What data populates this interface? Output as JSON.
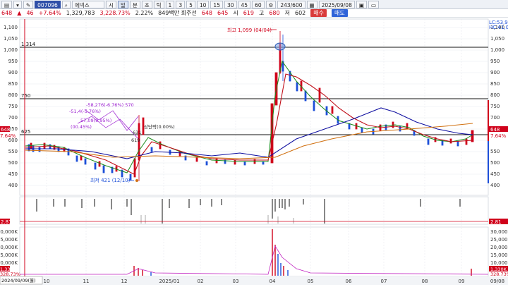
{
  "toolbar": {
    "left_icons": [
      "pin-icon",
      "dropdown-icon",
      "edit-icon"
    ],
    "stock_code": "007096",
    "stock_name": "에넥스",
    "period_buttons": [
      "시",
      "일",
      "분",
      "초",
      "틱"
    ],
    "interval_buttons": [
      "1",
      "3",
      "5",
      "10",
      "15",
      "30",
      "45",
      "60"
    ],
    "count": "243/600",
    "date": "2025/09/08"
  },
  "quote": {
    "price": "648",
    "change": "46",
    "change_pct": "+7.64%",
    "volume": "1,329,783",
    "volume_pct": "3,228.73%",
    "turnover_pct": "2.22%",
    "amount_label": "849백만 회주선",
    "last": "648",
    "open": "645",
    "open_label": "시",
    "open_val": "619",
    "high_label": "고",
    "high_val": "680",
    "low_label": "저",
    "low_val": "602",
    "buy_label": "매수",
    "sell_label": "매도"
  },
  "chart": {
    "y_ticks": [
      "1,100",
      "1,050",
      "1,000",
      "950",
      "900",
      "850",
      "800",
      "750",
      "700",
      "650",
      "600",
      "550",
      "500",
      "450",
      "400"
    ],
    "x_ticks": [
      "10",
      "11",
      "12",
      "2025/01",
      "02",
      "03",
      "04",
      "05",
      "06",
      "07",
      "08",
      "09",
      "09/08"
    ],
    "start_date": "2024/09/09(월)",
    "high_annotation": "최고 1,099 (04/04)",
    "low_annotation": "최저 421 (12/10)",
    "level_1314": "1,314",
    "level_750": "750",
    "level_625": "625",
    "price_tag": "648",
    "price_tag_pct": "7.64%",
    "right_top": "LC:53,92",
    "right_top2": "HC:41,0",
    "volume_ticks": [
      "30,000K",
      "25,000K",
      "20,000K",
      "15,000K",
      "10,000K",
      "5,000K"
    ],
    "volume_tag": "1,330K",
    "volume_tag2": "328.73%",
    "mid_tag": "2.81",
    "pattern_labels": [
      "-58,276(-6.76%) 570",
      "-51,4(-5.76%)",
      "57,09(9.95%)",
      "(00.45%)",
      "631",
      "619",
      "상단락(0.00%)"
    ],
    "colors": {
      "up": "#d0021b",
      "down": "#1d4fd8",
      "ma5": "#1a8a1a",
      "ma20": "#c0101a",
      "ma60": "#1010a0",
      "ma120": "#d07010",
      "frame": "#d0021b"
    }
  }
}
